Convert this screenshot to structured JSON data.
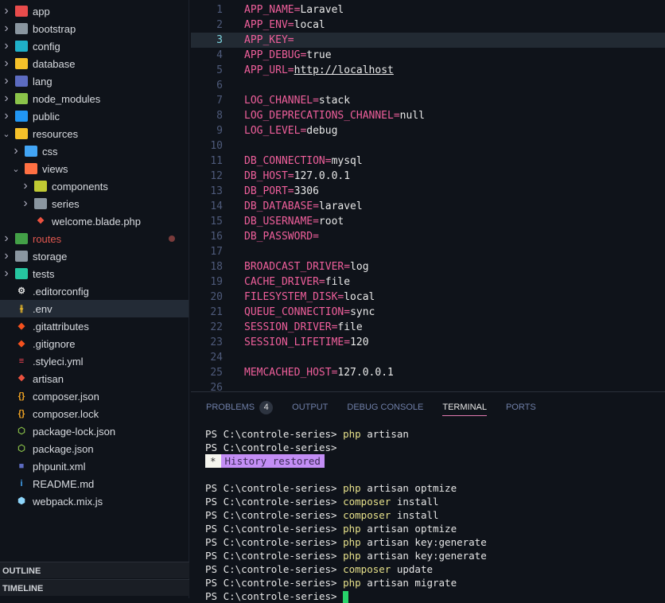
{
  "explorer": {
    "items": [
      {
        "label": "app",
        "depth": 0,
        "chevron": "right",
        "icon": "folder-app-icon",
        "color": "#e84c4c"
      },
      {
        "label": "bootstrap",
        "depth": 0,
        "chevron": "right",
        "icon": "folder-icon",
        "color": "#8a96a0"
      },
      {
        "label": "config",
        "depth": 0,
        "chevron": "right",
        "icon": "folder-config-icon",
        "color": "#1fb0c8"
      },
      {
        "label": "database",
        "depth": 0,
        "chevron": "right",
        "icon": "folder-database-icon",
        "color": "#f5c12a"
      },
      {
        "label": "lang",
        "depth": 0,
        "chevron": "right",
        "icon": "folder-lang-icon",
        "color": "#5c6bc0"
      },
      {
        "label": "node_modules",
        "depth": 0,
        "chevron": "right",
        "icon": "folder-node-icon",
        "color": "#8bc34a"
      },
      {
        "label": "public",
        "depth": 0,
        "chevron": "right",
        "icon": "folder-public-icon",
        "color": "#2196f3"
      },
      {
        "label": "resources",
        "depth": 0,
        "chevron": "down",
        "icon": "folder-resources-open-icon",
        "color": "#f5c12a"
      },
      {
        "label": "css",
        "depth": 1,
        "chevron": "right",
        "icon": "folder-css-icon",
        "color": "#42a5f5"
      },
      {
        "label": "views",
        "depth": 1,
        "chevron": "down",
        "icon": "folder-views-open-icon",
        "color": "#ff7043"
      },
      {
        "label": "components",
        "depth": 2,
        "chevron": "right",
        "icon": "folder-components-icon",
        "color": "#c0ca33"
      },
      {
        "label": "series",
        "depth": 2,
        "chevron": "right",
        "icon": "folder-icon",
        "color": "#8a96a0"
      },
      {
        "label": "welcome.blade.php",
        "depth": 2,
        "chevron": "",
        "icon": "laravel-icon",
        "color": "#f05340"
      },
      {
        "label": "routes",
        "depth": 0,
        "chevron": "right",
        "icon": "folder-routes-icon",
        "color": "#43a047",
        "modified": true,
        "labelColor": "#e0574f"
      },
      {
        "label": "storage",
        "depth": 0,
        "chevron": "right",
        "icon": "folder-icon",
        "color": "#8a96a0"
      },
      {
        "label": "tests",
        "depth": 0,
        "chevron": "right",
        "icon": "folder-tests-icon",
        "color": "#26c6a0"
      },
      {
        "label": ".editorconfig",
        "depth": 0,
        "chevron": "",
        "icon": "editorconfig-icon",
        "color": "#e0e0e0"
      },
      {
        "label": ".env",
        "depth": 0,
        "chevron": "",
        "icon": "tune-icon",
        "color": "#f5c12a",
        "selected": true
      },
      {
        "label": ".gitattributes",
        "depth": 0,
        "chevron": "",
        "icon": "git-icon",
        "color": "#f4511e"
      },
      {
        "label": ".gitignore",
        "depth": 0,
        "chevron": "",
        "icon": "git-icon",
        "color": "#f4511e"
      },
      {
        "label": ".styleci.yml",
        "depth": 0,
        "chevron": "",
        "icon": "yaml-file-icon",
        "color": "#f44355"
      },
      {
        "label": "artisan",
        "depth": 0,
        "chevron": "",
        "icon": "laravel-icon",
        "color": "#f05340"
      },
      {
        "label": "composer.json",
        "depth": 0,
        "chevron": "",
        "icon": "braces-icon",
        "color": "#f5a623"
      },
      {
        "label": "composer.lock",
        "depth": 0,
        "chevron": "",
        "icon": "braces-icon",
        "color": "#f5a623"
      },
      {
        "label": "package-lock.json",
        "depth": 0,
        "chevron": "",
        "icon": "nodejs-icon",
        "color": "#8bc34a"
      },
      {
        "label": "package.json",
        "depth": 0,
        "chevron": "",
        "icon": "nodejs-icon",
        "color": "#8bc34a"
      },
      {
        "label": "phpunit.xml",
        "depth": 0,
        "chevron": "",
        "icon": "phpunit-icon",
        "color": "#5c6bc0"
      },
      {
        "label": "README.md",
        "depth": 0,
        "chevron": "",
        "icon": "info-icon",
        "color": "#42a5f5"
      },
      {
        "label": "webpack.mix.js",
        "depth": 0,
        "chevron": "",
        "icon": "webpack-icon",
        "color": "#8ed6fb"
      }
    ]
  },
  "sections": {
    "outline": "OUTLINE",
    "timeline": "TIMELINE"
  },
  "editor": {
    "current_line": 3,
    "lines": [
      {
        "n": "1",
        "k": "APP_NAME",
        "v": "Laravel"
      },
      {
        "n": "2",
        "k": "APP_ENV",
        "v": "local"
      },
      {
        "n": "3",
        "k": "APP_KEY",
        "v": ""
      },
      {
        "n": "4",
        "k": "APP_DEBUG",
        "v": "true"
      },
      {
        "n": "5",
        "k": "APP_URL",
        "v": "http://localhost",
        "link": true
      },
      {
        "n": "6"
      },
      {
        "n": "7",
        "k": "LOG_CHANNEL",
        "v": "stack"
      },
      {
        "n": "8",
        "k": "LOG_DEPRECATIONS_CHANNEL",
        "v": "null"
      },
      {
        "n": "9",
        "k": "LOG_LEVEL",
        "v": "debug"
      },
      {
        "n": "10"
      },
      {
        "n": "11",
        "k": "DB_CONNECTION",
        "v": "mysql"
      },
      {
        "n": "12",
        "k": "DB_HOST",
        "v": "127.0.0.1"
      },
      {
        "n": "13",
        "k": "DB_PORT",
        "v": "3306"
      },
      {
        "n": "14",
        "k": "DB_DATABASE",
        "v": "laravel"
      },
      {
        "n": "15",
        "k": "DB_USERNAME",
        "v": "root"
      },
      {
        "n": "16",
        "k": "DB_PASSWORD",
        "v": ""
      },
      {
        "n": "17"
      },
      {
        "n": "18",
        "k": "BROADCAST_DRIVER",
        "v": "log"
      },
      {
        "n": "19",
        "k": "CACHE_DRIVER",
        "v": "file"
      },
      {
        "n": "20",
        "k": "FILESYSTEM_DISK",
        "v": "local"
      },
      {
        "n": "21",
        "k": "QUEUE_CONNECTION",
        "v": "sync"
      },
      {
        "n": "22",
        "k": "SESSION_DRIVER",
        "v": "file"
      },
      {
        "n": "23",
        "k": "SESSION_LIFETIME",
        "v": "120"
      },
      {
        "n": "24"
      },
      {
        "n": "25",
        "k": "MEMCACHED_HOST",
        "v": "127.0.0.1"
      },
      {
        "n": "26"
      }
    ]
  },
  "panel": {
    "tabs": [
      {
        "label": "PROBLEMS",
        "badge": "4"
      },
      {
        "label": "OUTPUT"
      },
      {
        "label": "DEBUG CONSOLE"
      },
      {
        "label": "TERMINAL",
        "active": true
      },
      {
        "label": "PORTS"
      }
    ]
  },
  "terminal": {
    "prompt": "PS C:\\controle-series>",
    "history_star": "*",
    "history_text": "History restored",
    "lines": [
      {
        "cmd": "php",
        "args": " artisan"
      },
      {
        "cmd": "",
        "args": ""
      },
      {
        "history": true
      },
      {
        "blank": true
      },
      {
        "cmd": "php",
        "args": " artisan optmize"
      },
      {
        "cmd": "composer",
        "args": " install"
      },
      {
        "cmd": "composer",
        "args": " install"
      },
      {
        "cmd": "php",
        "args": " artisan optmize"
      },
      {
        "cmd": "php",
        "args": " artisan key:generate"
      },
      {
        "cmd": "php",
        "args": " artisan key:generate"
      },
      {
        "cmd": "composer",
        "args": " update"
      },
      {
        "cmd": "php",
        "args": " artisan migrate"
      },
      {
        "cmd": "",
        "args": "",
        "cursor": true
      }
    ]
  },
  "colors": {
    "key": "#ef5f9b",
    "value": "#e8e8e8",
    "command": "#e6e08a",
    "history_bg": "#c38ef5",
    "cursor": "#27d36a",
    "active_tab_underline": "#e07ab0"
  }
}
